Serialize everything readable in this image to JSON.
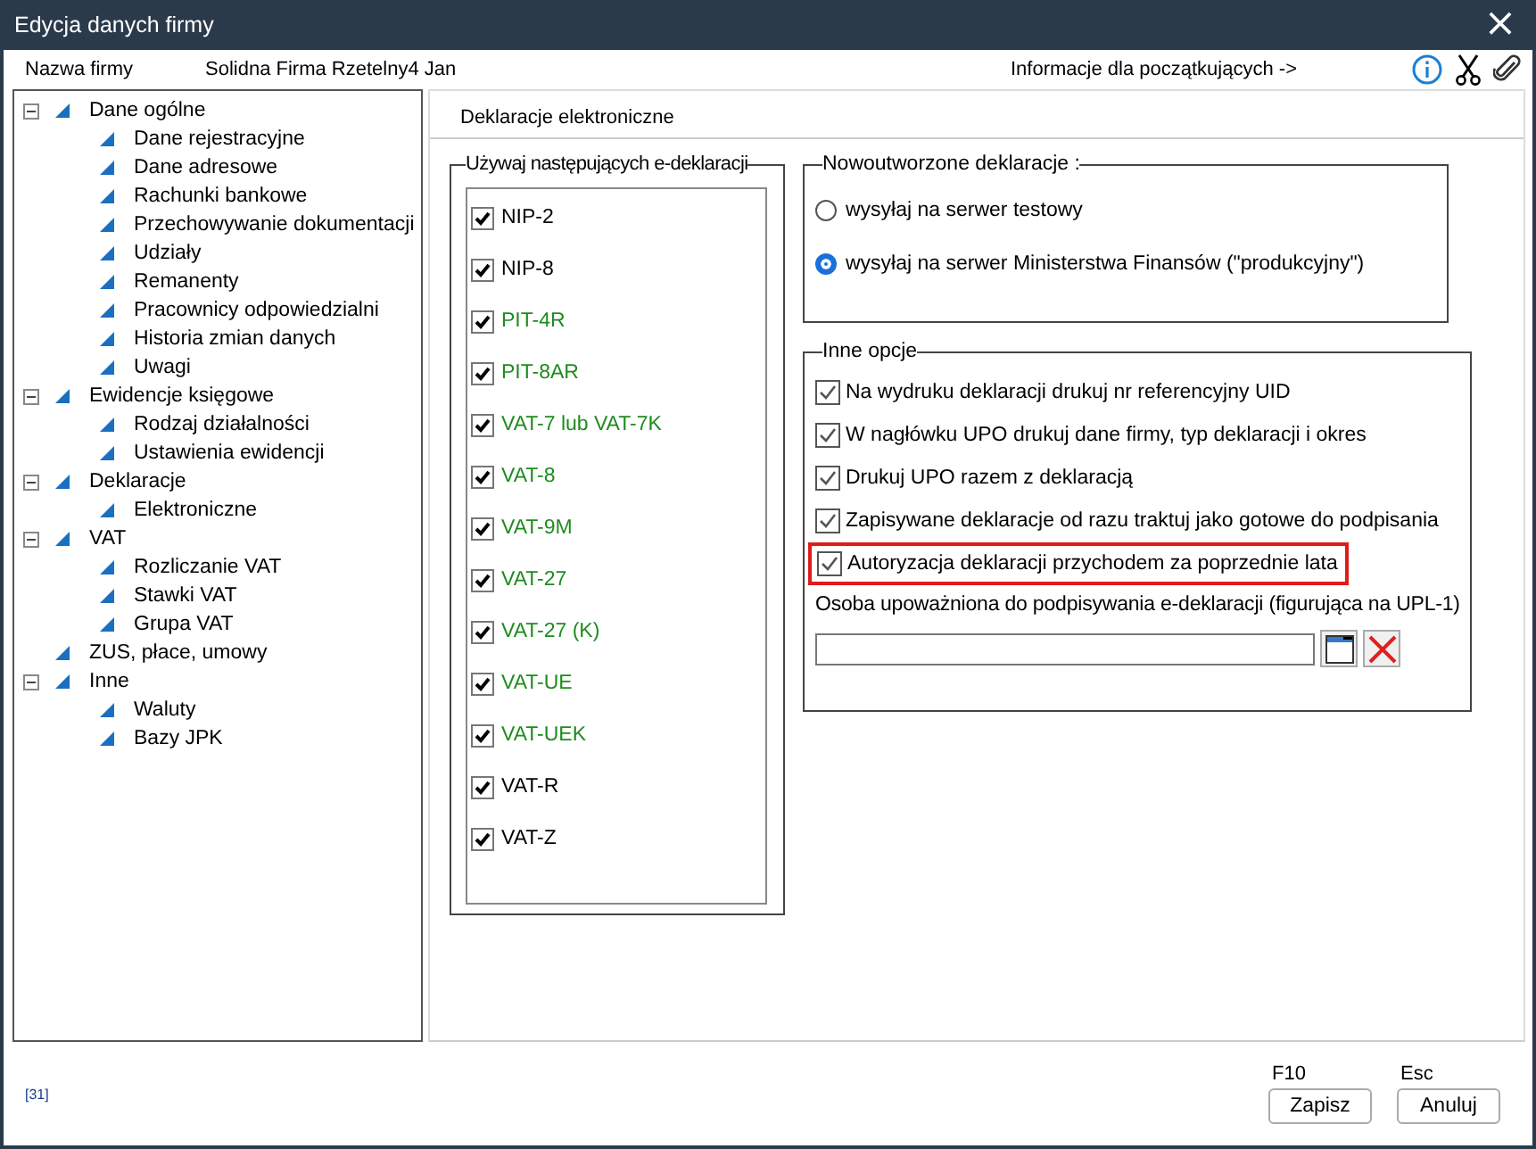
{
  "window": {
    "title": "Edycja danych firmy",
    "close": "×"
  },
  "info_bar": {
    "label": "Nazwa firmy",
    "company": "Solidna Firma Rzetelny4 Jan",
    "help_link": "Informacje dla początkujących ->"
  },
  "tree": [
    {
      "label": "Dane ogólne",
      "expanded": true,
      "children": [
        {
          "label": "Dane rejestracyjne"
        },
        {
          "label": "Dane adresowe"
        },
        {
          "label": "Rachunki bankowe"
        },
        {
          "label": "Przechowywanie dokumentacji"
        },
        {
          "label": "Udziały"
        },
        {
          "label": "Remanenty"
        },
        {
          "label": "Pracownicy odpowiedzialni"
        },
        {
          "label": "Historia zmian danych"
        },
        {
          "label": "Uwagi"
        }
      ]
    },
    {
      "label": "Ewidencje księgowe",
      "expanded": true,
      "children": [
        {
          "label": "Rodzaj działalności"
        },
        {
          "label": "Ustawienia ewidencji"
        }
      ]
    },
    {
      "label": "Deklaracje",
      "expanded": true,
      "children": [
        {
          "label": "Elektroniczne"
        }
      ]
    },
    {
      "label": "VAT",
      "expanded": true,
      "children": [
        {
          "label": "Rozliczanie VAT"
        },
        {
          "label": "Stawki VAT"
        },
        {
          "label": "Grupa VAT"
        }
      ]
    },
    {
      "label": "ZUS, płace, umowy"
    },
    {
      "label": "Inne",
      "expanded": true,
      "children": [
        {
          "label": "Waluty"
        },
        {
          "label": "Bazy JPK"
        }
      ]
    }
  ],
  "tab": {
    "label": "Deklaracje elektroniczne"
  },
  "declarations": {
    "title": "Używaj następujących e-deklaracji",
    "items": [
      {
        "label": "NIP-2",
        "checked": true,
        "color": "#000000"
      },
      {
        "label": "NIP-8",
        "checked": true,
        "color": "#000000"
      },
      {
        "label": "PIT-4R",
        "checked": true,
        "color": "#1e8c1e"
      },
      {
        "label": "PIT-8AR",
        "checked": true,
        "color": "#1e8c1e"
      },
      {
        "label": "VAT-7 lub VAT-7K",
        "checked": true,
        "color": "#1e8c1e"
      },
      {
        "label": "VAT-8",
        "checked": true,
        "color": "#1e8c1e"
      },
      {
        "label": "VAT-9M",
        "checked": true,
        "color": "#1e8c1e"
      },
      {
        "label": "VAT-27",
        "checked": true,
        "color": "#1e8c1e"
      },
      {
        "label": "VAT-27 (K)",
        "checked": true,
        "color": "#1e8c1e"
      },
      {
        "label": "VAT-UE",
        "checked": true,
        "color": "#1e8c1e"
      },
      {
        "label": "VAT-UEK",
        "checked": true,
        "color": "#1e8c1e"
      },
      {
        "label": "VAT-R",
        "checked": true,
        "color": "#000000"
      },
      {
        "label": "VAT-Z",
        "checked": true,
        "color": "#000000"
      }
    ]
  },
  "new_declarations": {
    "title": "Nowoutworzone deklaracje :",
    "options": [
      {
        "label": "wysyłaj na serwer testowy",
        "selected": false
      },
      {
        "label": "wysyłaj na serwer Ministerstwa Finansów (\"produkcyjny\")",
        "selected": true
      }
    ]
  },
  "other_options": {
    "title": "Inne opcje",
    "items": [
      {
        "label": "Na wydruku deklaracji drukuj nr referencyjny UID",
        "checked": true,
        "highlighted": false
      },
      {
        "label": "W nagłówku UPO drukuj dane firmy, typ deklaracji i okres",
        "checked": true,
        "highlighted": false
      },
      {
        "label": "Drukuj UPO razem z deklaracją",
        "checked": true,
        "highlighted": false
      },
      {
        "label": "Zapisywane deklaracje od razu traktuj jako gotowe do podpisania",
        "checked": true,
        "highlighted": false
      },
      {
        "label": "Autoryzacja deklaracji przychodem za poprzednie lata",
        "checked": true,
        "highlighted": true
      }
    ],
    "person_label": "Osoba upoważniona do podpisywania e-deklaracji (figurująca na UPL-1)"
  },
  "footer": {
    "code": "[31]",
    "buttons": [
      {
        "key": "F10",
        "label": "Zapisz"
      },
      {
        "key": "Esc",
        "label": "Anuluj"
      }
    ]
  }
}
